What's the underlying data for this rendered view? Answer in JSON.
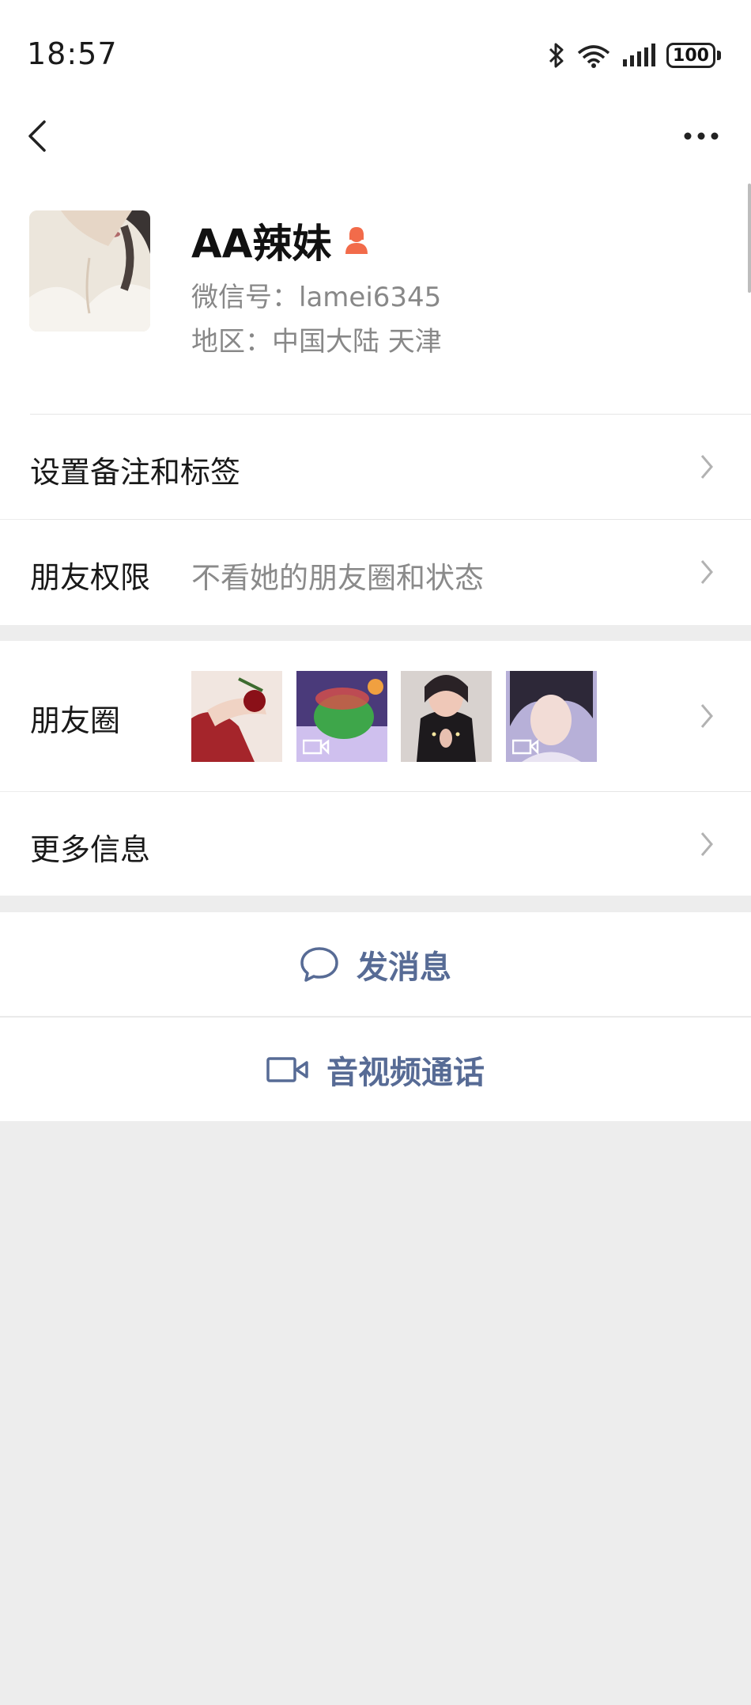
{
  "status_bar": {
    "time": "18:57",
    "battery": "100",
    "icons": [
      "bluetooth-icon",
      "wifi-icon",
      "signal-icon",
      "battery-icon"
    ]
  },
  "nav": {
    "back_icon": "chevron-left-icon",
    "more_icon": "more-dots-icon"
  },
  "profile": {
    "name": "AA辣妹",
    "gender_icon": "female-icon",
    "wechat_id": "微信号：lamei6345",
    "region": "地区：中国大陆  天津"
  },
  "rows": {
    "remark": {
      "label": "设置备注和标签"
    },
    "permissions": {
      "label": "朋友权限",
      "value": "不看她的朋友圈和状态"
    },
    "moments": {
      "label": "朋友圈"
    },
    "more_info": {
      "label": "更多信息"
    }
  },
  "actions": {
    "message": {
      "label": "发消息",
      "icon": "chat-bubble-icon"
    },
    "call": {
      "label": "音视频通话",
      "icon": "video-call-icon"
    }
  },
  "colors": {
    "link_blue": "#576b95",
    "female_icon": "#f26b4a",
    "background": "#ededed"
  }
}
